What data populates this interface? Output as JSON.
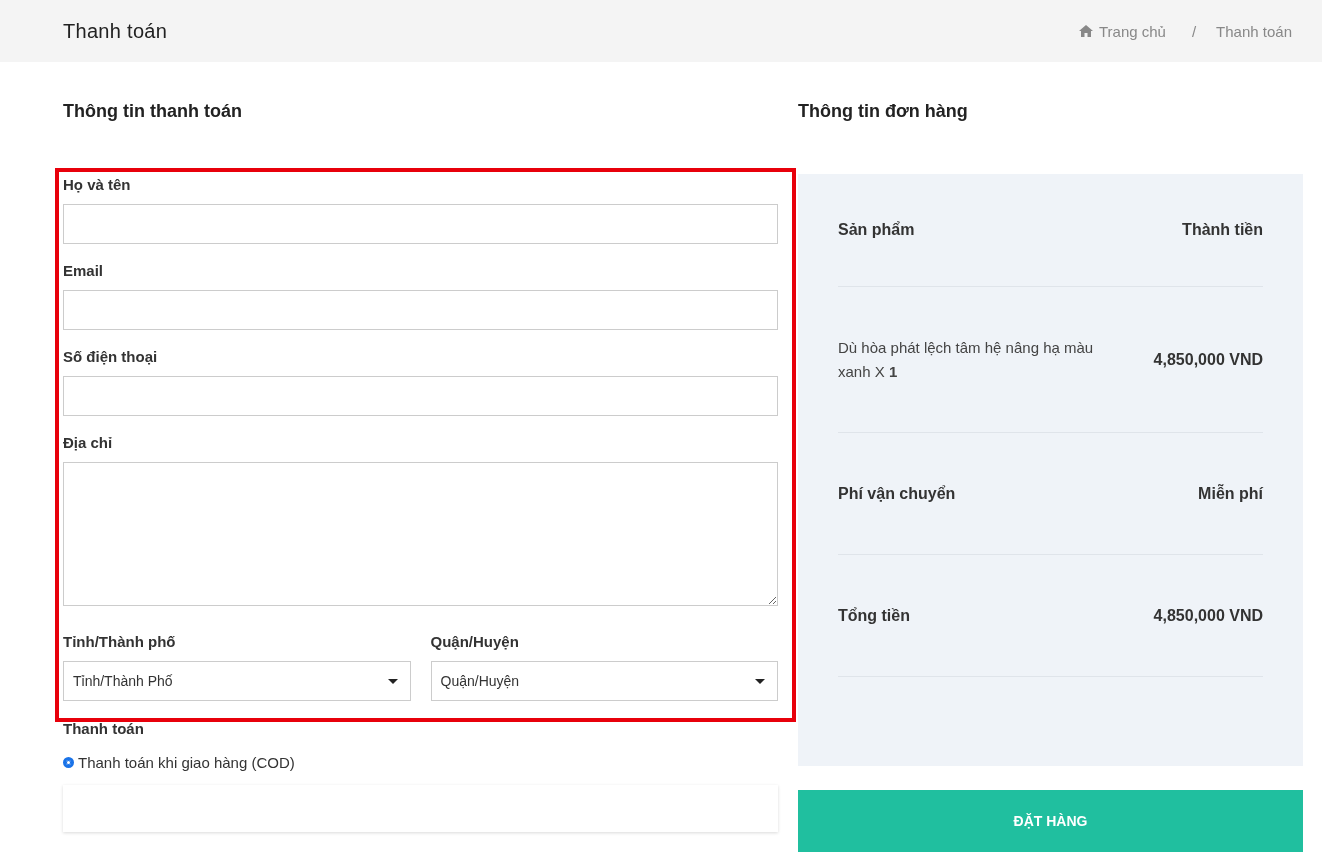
{
  "header": {
    "title": "Thanh toán",
    "breadcrumb": [
      {
        "label": "Trang chủ",
        "kind": "home"
      },
      {
        "label": "Thanh toán",
        "kind": "current"
      }
    ],
    "separator": "/"
  },
  "billing": {
    "title": "Thông tin thanh toán",
    "fields": [
      {
        "kind": "text",
        "label": "Họ và tên"
      },
      {
        "kind": "text",
        "label": "Email"
      },
      {
        "kind": "text",
        "label": "Số điện thoại"
      },
      {
        "kind": "textarea",
        "label": "Địa chỉ"
      }
    ],
    "selects": [
      {
        "label": "Tỉnh/Thành phố",
        "value": "Tỉnh/Thành Phố"
      },
      {
        "label": "Quận/Huyện",
        "value": "Quận/Huyện"
      }
    ],
    "payment": {
      "title": "Thanh toán",
      "options": [
        {
          "label": "Thanh toán khi giao hàng (COD)",
          "selected": true
        }
      ]
    }
  },
  "order": {
    "title": "Thông tin đơn hàng",
    "columns": [
      "Sản phẩm",
      "Thành tiền"
    ],
    "items": [
      {
        "name": "Dù hòa phát lệch tâm hệ nâng hạ màu xanh X **1**",
        "price": "4,850,000 VND"
      }
    ],
    "shipping": {
      "label": "Phí vận chuyển",
      "value": "Miễn phí"
    },
    "total": {
      "label": "Tổng tiền",
      "value": "4,850,000 VND"
    }
  },
  "submit": "ĐẶT HÀNG"
}
